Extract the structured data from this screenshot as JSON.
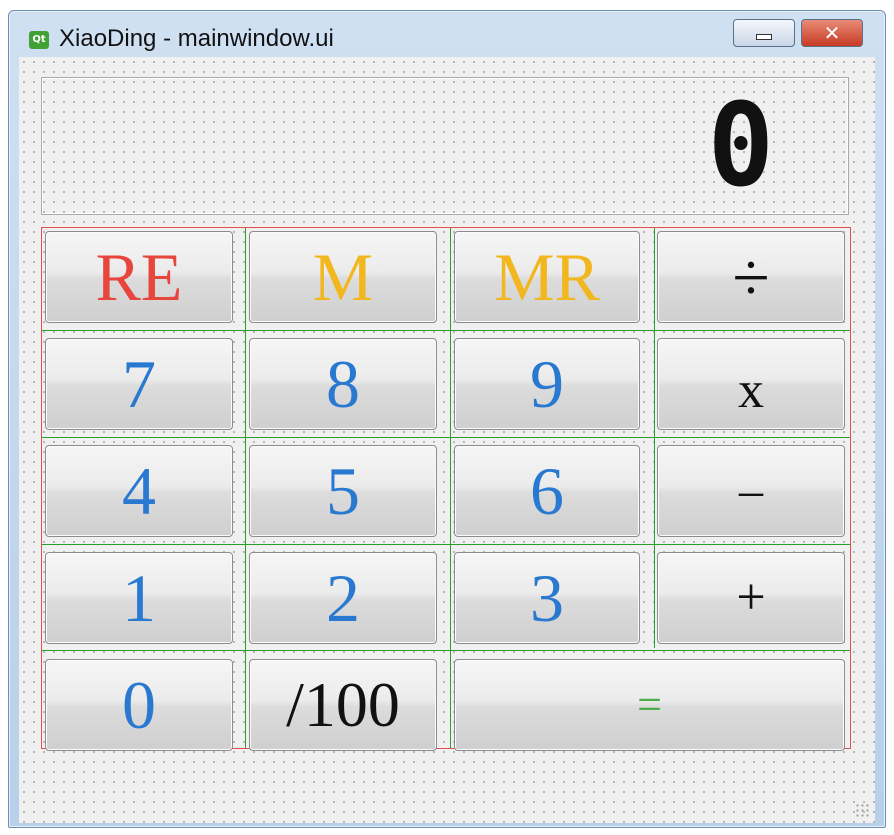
{
  "window": {
    "title": "XiaoDing - mainwindow.ui",
    "app_icon": "Qt",
    "close_glyph": "✕"
  },
  "display": {
    "value": "0"
  },
  "buttons": {
    "re": "RE",
    "m": "M",
    "mr": "MR",
    "divide": "÷",
    "seven": "7",
    "eight": "8",
    "nine": "9",
    "multiply": "x",
    "four": "4",
    "five": "5",
    "six": "6",
    "minus": "–",
    "one": "1",
    "two": "2",
    "three": "3",
    "plus": "+",
    "zero": "0",
    "percent": "/100",
    "equals": "="
  },
  "colors": {
    "digit": "#2a79d0",
    "reset": "#e8453c",
    "memory": "#f2b71e",
    "operator": "#111111",
    "equals": "#4cad4c",
    "layout_border": "#e05050",
    "grid_line": "#2aa02a"
  }
}
